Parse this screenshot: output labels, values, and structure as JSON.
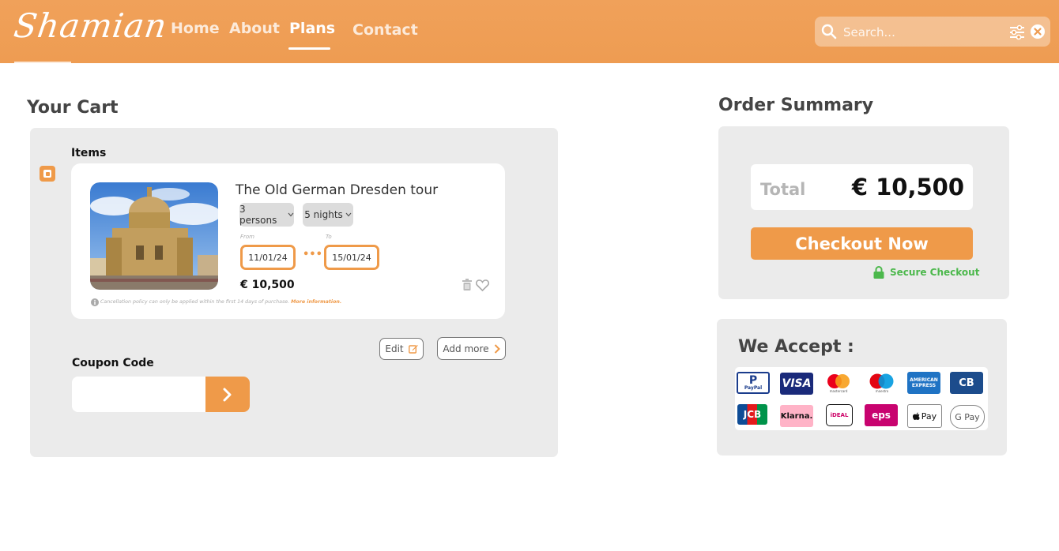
{
  "header": {
    "logo": "Shamian",
    "nav": [
      "Home",
      "About",
      "Plans",
      "Contact"
    ],
    "active_nav": "Plans",
    "search_placeholder": "Search..."
  },
  "cart": {
    "title": "Your Cart",
    "items_label": "Items",
    "item": {
      "name": "The Old German Dresden tour",
      "persons": "3 persons",
      "nights": "5 nights",
      "from_label": "From",
      "to_label": "To",
      "from_date": "11/01/24",
      "to_date": "15/01/24",
      "dots": "•••",
      "price": "€ 10,500",
      "policy_text": "Cancellation policy can only be applied within the first 14 days of purchase.",
      "policy_link": "More information."
    },
    "edit_label": "Edit",
    "add_more_label": "Add more",
    "coupon_label": "Coupon Code"
  },
  "summary": {
    "title": "Order Summary",
    "total_label": "Total",
    "total_value": "€ 10,500",
    "checkout_label": "Checkout Now",
    "secure_label": "Secure Checkout"
  },
  "accept": {
    "title": "We Accept :",
    "methods": [
      "PayPal",
      "VISA",
      "mastercard",
      "maestro",
      "AMERICAN EXPRESS",
      "CB",
      "JCB",
      "Klarna.",
      "iDEAL",
      "eps",
      "Pay",
      "G Pay"
    ]
  },
  "colors": {
    "accent": "#ef9a49",
    "header": "#ee9c52",
    "panel": "#ebebeb",
    "secure_green": "#4cb84c"
  }
}
